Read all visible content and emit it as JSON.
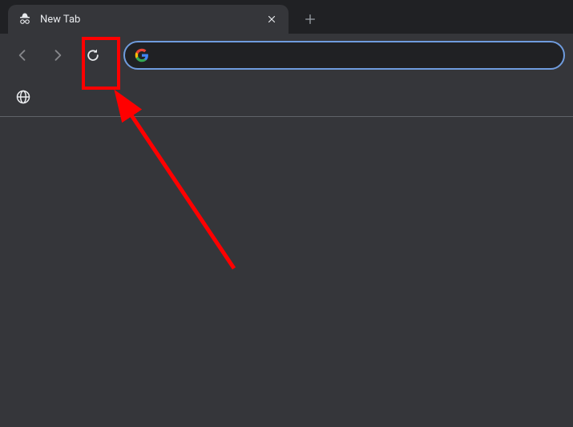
{
  "tab": {
    "title": "New Tab",
    "icon_name": "incognito-icon"
  },
  "toolbar": {
    "omnibox_value": "",
    "omnibox_placeholder": ""
  },
  "annotation": {
    "highlight_target": "reload-button",
    "color": "#ff0000"
  }
}
